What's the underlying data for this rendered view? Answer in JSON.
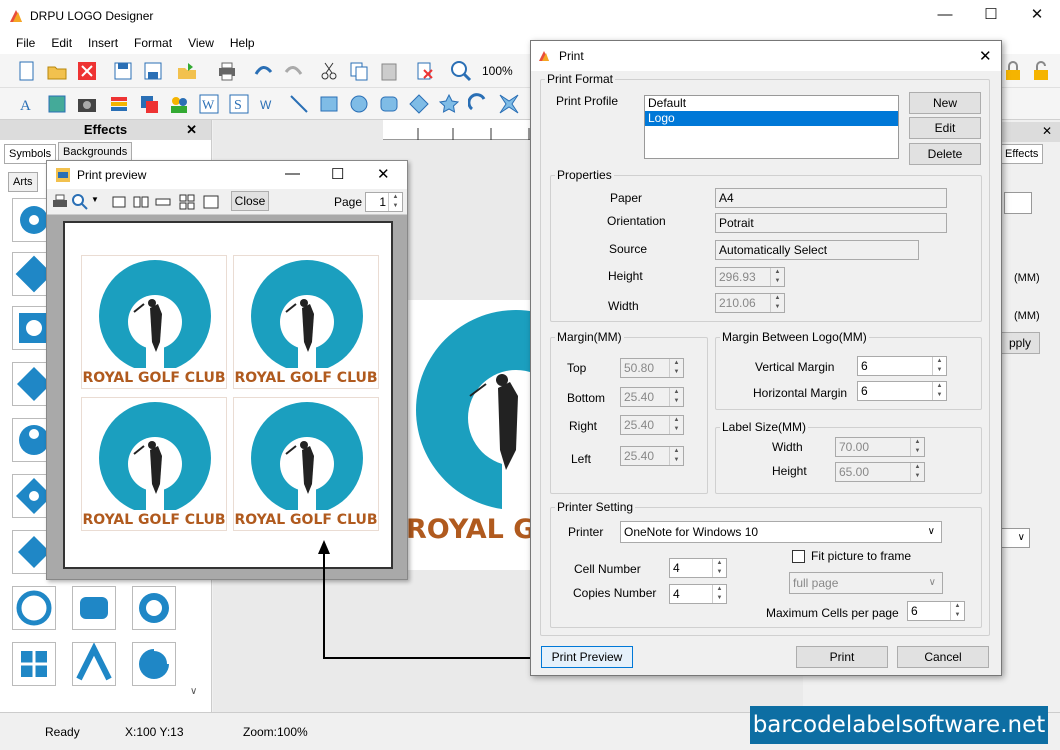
{
  "app": {
    "title": "DRPU LOGO Designer"
  },
  "menu": [
    "File",
    "Edit",
    "Insert",
    "Format",
    "View",
    "Help"
  ],
  "toolbar": {
    "zoom": "100%"
  },
  "effects": {
    "title": "Effects",
    "tabs": [
      "Symbols",
      "Backgrounds"
    ],
    "arts_label": "Arts"
  },
  "right_panel": {
    "effects_tab": "Effects",
    "mm1": "(MM)",
    "mm2": "(MM)",
    "apply": "pply"
  },
  "canvas": {
    "logo_text": "ROYAL GOF"
  },
  "preview": {
    "title": "Print preview",
    "close_label": "Close",
    "page_label": "Page",
    "page_value": "1",
    "label_text": "ROYAL GOLF CLUB"
  },
  "print": {
    "title": "Print",
    "format_legend": "Print Format",
    "profile_label": "Print Profile",
    "profiles": [
      "Default",
      "Logo"
    ],
    "selected_profile": "Logo",
    "new_btn": "New",
    "edit_btn": "Edit",
    "delete_btn": "Delete",
    "properties_legend": "Properties",
    "paper_label": "Paper",
    "paper_value": "A4",
    "orientation_label": "Orientation",
    "orientation_value": "Potrait",
    "source_label": "Source",
    "source_value": "Automatically Select",
    "height_label": "Height",
    "height_value": "296.93",
    "width_label": "Width",
    "width_value": "210.06",
    "margin_legend": "Margin(MM)",
    "top_label": "Top",
    "top_value": "50.80",
    "bottom_label": "Bottom",
    "bottom_value": "25.40",
    "right_label": "Right",
    "right_value": "25.40",
    "left_label": "Left",
    "left_value": "25.40",
    "mbl_legend": "Margin Between Logo(MM)",
    "vmargin_label": "Vertical Margin",
    "vmargin_value": "6",
    "hmargin_label": "Horizontal Margin",
    "hmargin_value": "6",
    "labelsize_legend": "Label Size(MM)",
    "lwidth_label": "Width",
    "lwidth_value": "70.00",
    "lheight_label": "Height",
    "lheight_value": "65.00",
    "printer_legend": "Printer Setting",
    "printer_label": "Printer",
    "printer_value": "OneNote for Windows 10",
    "fit_label": "Fit picture to frame",
    "fullpage_value": "full page",
    "cell_label": "Cell Number",
    "cell_value": "4",
    "copies_label": "Copies Number",
    "copies_value": "4",
    "maxcells_label": "Maximum Cells per page",
    "maxcells_value": "6",
    "preview_btn": "Print Preview",
    "print_btn": "Print",
    "cancel_btn": "Cancel"
  },
  "status": {
    "ready": "Ready",
    "coords": "X:100  Y:13",
    "zoom": "Zoom:100%"
  },
  "watermark": "barcodelabelsoftware.net",
  "colors": {
    "teal": "#1b9fbf",
    "brand_text": "#b05a1e",
    "accent": "#0078d7"
  }
}
